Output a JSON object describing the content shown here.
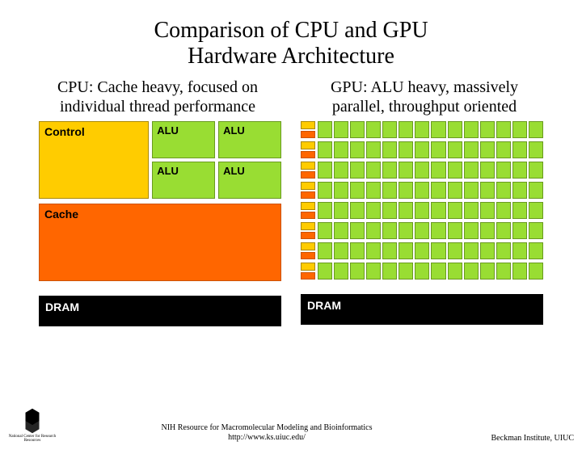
{
  "title_line1": "Comparison of CPU and GPU",
  "title_line2": "Hardware Architecture",
  "cpu_subtitle": "CPU: Cache heavy, focused on individual thread performance",
  "gpu_subtitle": "GPU: ALU heavy, massively parallel, throughput oriented",
  "labels": {
    "control": "Control",
    "alu": "ALU",
    "cache": "Cache",
    "dram": "DRAM"
  },
  "gpu": {
    "rows": 8,
    "alus_per_row": 14
  },
  "footer": {
    "resource_line1": "NIH Resource for Macromolecular Modeling and Bioinformatics",
    "resource_line2": "http://www.ks.uiuc.edu/",
    "institute": "Beckman Institute, UIUC",
    "left_caption": "National Center for Research Resources"
  },
  "colors": {
    "control": "#ffcc00",
    "alu": "#99dd33",
    "cache": "#ff6600",
    "dram": "#000000"
  }
}
